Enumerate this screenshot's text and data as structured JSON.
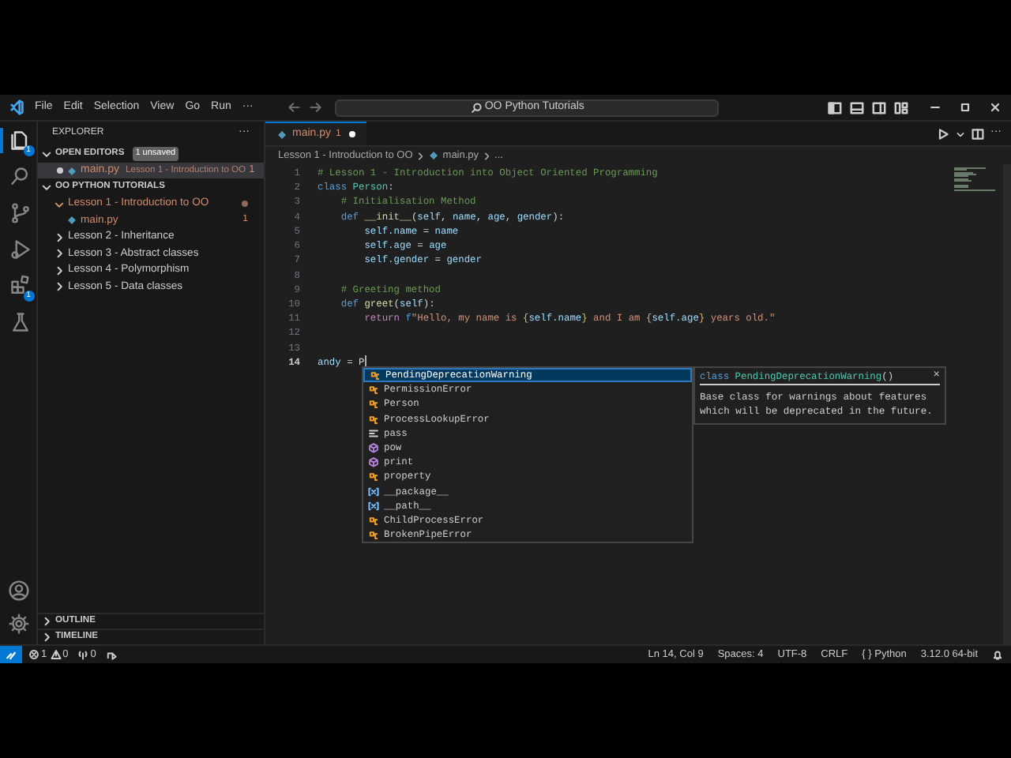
{
  "menu": [
    "File",
    "Edit",
    "Selection",
    "View",
    "Go",
    "Run",
    "···"
  ],
  "search": {
    "value": "OO Python Tutorials"
  },
  "activity": [
    {
      "kind": "files",
      "badge": "1",
      "selected": true
    },
    {
      "kind": "search",
      "selected": false
    },
    {
      "kind": "source-control",
      "selected": false
    },
    {
      "kind": "run",
      "selected": false
    },
    {
      "kind": "extensions",
      "badge": "1",
      "selected": false
    },
    {
      "kind": "testing",
      "selected": false
    }
  ],
  "sidebar": {
    "title": "EXPLORER",
    "more": "···",
    "open_editors": {
      "title": "OPEN EDITORS",
      "badge": "1 unsaved",
      "expanded": true,
      "items": [
        {
          "name": "main.py",
          "description": "Lesson 1 - Introduction to OO",
          "count": "1",
          "unsaved": true,
          "selected": true
        }
      ]
    },
    "folder": {
      "title": "OO PYTHON TUTORIALS",
      "expanded": true,
      "children": [
        {
          "name": "Lesson 1 - Introduction to OO",
          "kind": "folder",
          "expanded": true,
          "error": true,
          "children": [
            {
              "name": "main.py",
              "kind": "file",
              "count": "1"
            }
          ]
        },
        {
          "name": "Lesson 2 - Inheritance",
          "kind": "folder",
          "expanded": false,
          "error": false
        },
        {
          "name": "Lesson 3 - Abstract classes",
          "kind": "folder",
          "expanded": false,
          "error": false
        },
        {
          "name": "Lesson 4 - Polymorphism",
          "kind": "folder",
          "expanded": false,
          "error": false
        },
        {
          "name": "Lesson 5 - Data classes",
          "kind": "folder",
          "expanded": false,
          "error": false
        }
      ]
    },
    "panels": [
      {
        "title": "OUTLINE",
        "expanded": false
      },
      {
        "title": "TIMELINE",
        "expanded": false
      }
    ]
  },
  "tabs": [
    {
      "name": "main.py",
      "count": "1",
      "unsaved": true,
      "selected": true
    }
  ],
  "breadcrumb": [
    {
      "text": "Lesson 1 - Introduction to OO",
      "kind": "folder"
    },
    {
      "text": "main.py",
      "kind": "file"
    },
    {
      "text": "...",
      "kind": "symbol"
    }
  ],
  "code": [
    {
      "number": "1",
      "current": false,
      "tokens": [
        {
          "kind": "comment",
          "text": "# Lesson 1 - Introduction into Object Oriented Programming"
        }
      ]
    },
    {
      "number": "2",
      "current": false,
      "tokens": [
        {
          "kind": "keyword",
          "text": "class "
        },
        {
          "kind": "type",
          "text": "Person"
        },
        {
          "kind": "plain",
          "text": ":"
        }
      ]
    },
    {
      "number": "3",
      "current": false,
      "tokens": [
        {
          "kind": "comment",
          "text": "    # Initialisation Method"
        }
      ]
    },
    {
      "number": "4",
      "current": false,
      "tokens": [
        {
          "kind": "keyword",
          "text": "    def "
        },
        {
          "kind": "function",
          "text": "__init__"
        },
        {
          "kind": "plain",
          "text": "("
        },
        {
          "kind": "variable",
          "text": "self"
        },
        {
          "kind": "plain",
          "text": ", "
        },
        {
          "kind": "variable",
          "text": "name"
        },
        {
          "kind": "plain",
          "text": ", "
        },
        {
          "kind": "variable",
          "text": "age"
        },
        {
          "kind": "plain",
          "text": ", "
        },
        {
          "kind": "variable",
          "text": "gender"
        },
        {
          "kind": "plain",
          "text": "):"
        }
      ]
    },
    {
      "number": "5",
      "current": false,
      "tokens": [
        {
          "kind": "variable",
          "text": "        self.name"
        },
        {
          "kind": "plain",
          "text": " = "
        },
        {
          "kind": "variable",
          "text": "name"
        }
      ]
    },
    {
      "number": "6",
      "current": false,
      "tokens": [
        {
          "kind": "variable",
          "text": "        self.age"
        },
        {
          "kind": "plain",
          "text": " = "
        },
        {
          "kind": "variable",
          "text": "age"
        }
      ]
    },
    {
      "number": "7",
      "current": false,
      "tokens": [
        {
          "kind": "variable",
          "text": "        self.gender"
        },
        {
          "kind": "plain",
          "text": " = "
        },
        {
          "kind": "variable",
          "text": "gender"
        }
      ]
    },
    {
      "number": "8",
      "current": false
    },
    {
      "number": "9",
      "current": false,
      "tokens": [
        {
          "kind": "comment",
          "text": "    # Greeting method"
        }
      ]
    },
    {
      "number": "10",
      "current": false,
      "tokens": [
        {
          "kind": "keyword",
          "text": "    def "
        },
        {
          "kind": "function",
          "text": "greet"
        },
        {
          "kind": "plain",
          "text": "("
        },
        {
          "kind": "variable",
          "text": "self"
        },
        {
          "kind": "plain",
          "text": "):"
        }
      ]
    },
    {
      "number": "11",
      "current": false,
      "tokens": [
        {
          "kind": "control",
          "text": "        return "
        },
        {
          "kind": "keyword",
          "text": "f"
        },
        {
          "kind": "string",
          "text": "\"Hello, my name is "
        },
        {
          "kind": "brace",
          "text": "{"
        },
        {
          "kind": "variable",
          "text": "self.name"
        },
        {
          "kind": "brace",
          "text": "}"
        },
        {
          "kind": "string",
          "text": " and I am "
        },
        {
          "kind": "brace",
          "text": "{"
        },
        {
          "kind": "variable",
          "text": "self.age"
        },
        {
          "kind": "brace",
          "text": "}"
        },
        {
          "kind": "string",
          "text": " years old.\""
        }
      ]
    },
    {
      "number": "12",
      "current": false
    },
    {
      "number": "13",
      "current": false
    },
    {
      "number": "14",
      "current": true,
      "tokens": [
        {
          "kind": "variable",
          "text": "andy"
        },
        {
          "kind": "plain",
          "text": " = "
        },
        {
          "kind": "plain",
          "text": "P"
        }
      ]
    }
  ],
  "suggest": {
    "items": [
      {
        "label": "PendingDeprecationWarning",
        "kind": "class",
        "selected": true
      },
      {
        "label": "PermissionError",
        "kind": "class",
        "selected": false
      },
      {
        "label": "Person",
        "kind": "class",
        "selected": false
      },
      {
        "label": "ProcessLookupError",
        "kind": "class",
        "selected": false
      },
      {
        "label": "pass",
        "kind": "keyword",
        "selected": false
      },
      {
        "label": "pow",
        "kind": "function",
        "selected": false
      },
      {
        "label": "print",
        "kind": "function",
        "selected": false
      },
      {
        "label": "property",
        "kind": "class",
        "selected": false
      },
      {
        "label": "__package__",
        "kind": "variable",
        "selected": false
      },
      {
        "label": "__path__",
        "kind": "variable",
        "selected": false
      },
      {
        "label": "ChildProcessError",
        "kind": "class",
        "selected": false
      },
      {
        "label": "BrokenPipeError",
        "kind": "class",
        "selected": false
      }
    ],
    "details": {
      "keyword": "class",
      "name": "PendingDeprecationWarning",
      "params": "()",
      "close": "×",
      "doc": "Base class for warnings about features which will be deprecated in the future."
    }
  },
  "status": {
    "problems": [
      {
        "kind": "error",
        "count": "1"
      },
      {
        "kind": "warning",
        "count": "0"
      },
      {
        "kind": "ports",
        "count": "0"
      }
    ],
    "right": [
      "Ln 14, Col 9",
      "Spaces: 4",
      "UTF-8",
      "CRLF",
      "{ } Python",
      "3.12.0 64-bit"
    ]
  }
}
